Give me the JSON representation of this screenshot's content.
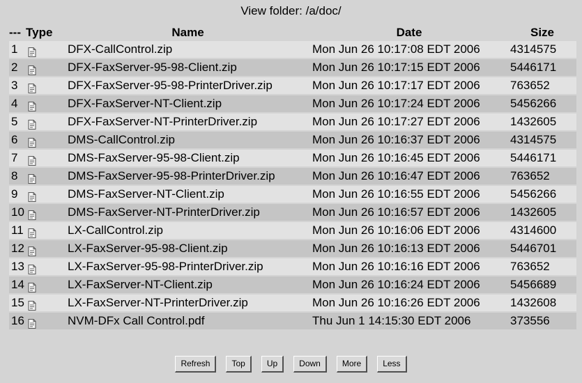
{
  "header": {
    "title": "View folder: /a/doc/"
  },
  "table": {
    "columns": {
      "num": "---",
      "type": "Type",
      "name": "Name",
      "date": "Date",
      "size": "Size"
    },
    "rows": [
      {
        "num": "1",
        "type_icon": "file-icon",
        "name": "DFX-CallControl.zip",
        "date": "Mon Jun 26 10:17:08 EDT 2006",
        "size": "4314575"
      },
      {
        "num": "2",
        "type_icon": "file-icon",
        "name": "DFX-FaxServer-95-98-Client.zip",
        "date": "Mon Jun 26 10:17:15 EDT 2006",
        "size": "5446171"
      },
      {
        "num": "3",
        "type_icon": "file-icon",
        "name": "DFX-FaxServer-95-98-PrinterDriver.zip",
        "date": "Mon Jun 26 10:17:17 EDT 2006",
        "size": "763652"
      },
      {
        "num": "4",
        "type_icon": "file-icon",
        "name": "DFX-FaxServer-NT-Client.zip",
        "date": "Mon Jun 26 10:17:24 EDT 2006",
        "size": "5456266"
      },
      {
        "num": "5",
        "type_icon": "file-icon",
        "name": "DFX-FaxServer-NT-PrinterDriver.zip",
        "date": "Mon Jun 26 10:17:27 EDT 2006",
        "size": "1432605"
      },
      {
        "num": "6",
        "type_icon": "file-icon",
        "name": "DMS-CallControl.zip",
        "date": "Mon Jun 26 10:16:37 EDT 2006",
        "size": "4314575"
      },
      {
        "num": "7",
        "type_icon": "file-icon",
        "name": "DMS-FaxServer-95-98-Client.zip",
        "date": "Mon Jun 26 10:16:45 EDT 2006",
        "size": "5446171"
      },
      {
        "num": "8",
        "type_icon": "file-icon",
        "name": "DMS-FaxServer-95-98-PrinterDriver.zip",
        "date": "Mon Jun 26 10:16:47 EDT 2006",
        "size": "763652"
      },
      {
        "num": "9",
        "type_icon": "file-icon",
        "name": "DMS-FaxServer-NT-Client.zip",
        "date": "Mon Jun 26 10:16:55 EDT 2006",
        "size": "5456266"
      },
      {
        "num": "10",
        "type_icon": "file-icon",
        "name": "DMS-FaxServer-NT-PrinterDriver.zip",
        "date": "Mon Jun 26 10:16:57 EDT 2006",
        "size": "1432605"
      },
      {
        "num": "11",
        "type_icon": "file-icon",
        "name": "LX-CallControl.zip",
        "date": "Mon Jun 26 10:16:06 EDT 2006",
        "size": "4314600"
      },
      {
        "num": "12",
        "type_icon": "file-icon",
        "name": "LX-FaxServer-95-98-Client.zip",
        "date": "Mon Jun 26 10:16:13 EDT 2006",
        "size": "5446701"
      },
      {
        "num": "13",
        "type_icon": "file-icon",
        "name": "LX-FaxServer-95-98-PrinterDriver.zip",
        "date": "Mon Jun 26 10:16:16 EDT 2006",
        "size": "763652"
      },
      {
        "num": "14",
        "type_icon": "file-icon",
        "name": "LX-FaxServer-NT-Client.zip",
        "date": "Mon Jun 26 10:16:24 EDT 2006",
        "size": "5456689"
      },
      {
        "num": "15",
        "type_icon": "file-icon",
        "name": "LX-FaxServer-NT-PrinterDriver.zip",
        "date": "Mon Jun 26 10:16:26 EDT 2006",
        "size": "1432608"
      },
      {
        "num": "16",
        "type_icon": "file-icon",
        "name": "NVM-DFx Call Control.pdf",
        "date": "Thu Jun 1 14:15:30 EDT 2006",
        "size": "373556"
      }
    ]
  },
  "toolbar": {
    "refresh_label": "Refresh",
    "top_label": "Top",
    "up_label": "Up",
    "down_label": "Down",
    "more_label": "More",
    "less_label": "Less"
  },
  "colors": {
    "page_background": "#d4d4d4",
    "row_light": "#e2e2e2",
    "row_dark": "#c5c5c5"
  }
}
